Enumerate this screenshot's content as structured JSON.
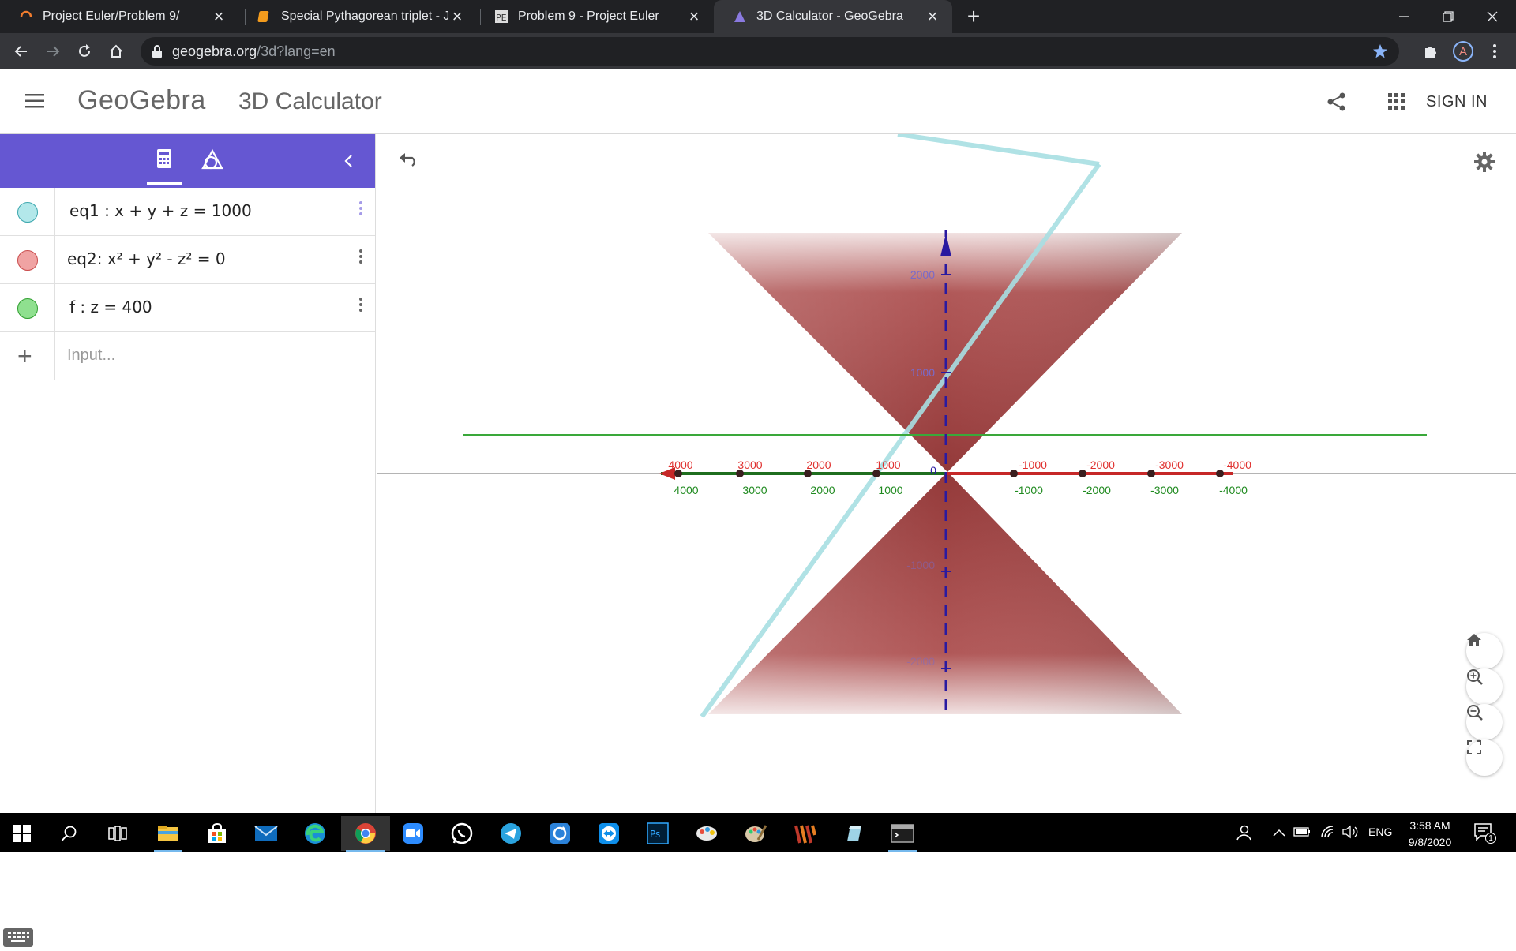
{
  "browser": {
    "tabs": [
      {
        "title": "Project Euler/Problem 9/",
        "icon": "loading-spinner-icon"
      },
      {
        "title": "Special Pythagorean triplet - Jupy",
        "icon": "notebook-icon"
      },
      {
        "title": "Problem 9 - Project Euler",
        "icon": "project-euler-icon"
      },
      {
        "title": "3D Calculator - GeoGebra",
        "icon": "geogebra-icon"
      }
    ],
    "active_tab_index": 3,
    "url_host": "geogebra.org",
    "url_path": "/3d?lang=en",
    "profile_initial": "A"
  },
  "app": {
    "logo": "GeoGebra",
    "name": "3D Calculator",
    "sign_in": "SIGN IN"
  },
  "algebra": {
    "rows": [
      {
        "expr": "eq1 : x + y + z = 1000",
        "color": "#b3e8ea",
        "border": "#3aa6ad"
      },
      {
        "expr": "eq2: x² + y² - z² = 0",
        "color": "#f0a3a3",
        "border": "#c94a4a"
      },
      {
        "expr": "f : z = 400",
        "color": "#8fe08f",
        "border": "#2e9e2e"
      }
    ],
    "input_placeholder": "Input..."
  },
  "graphics": {
    "x_ticks": [
      "4000",
      "3000",
      "2000",
      "1000",
      "0",
      "-1000",
      "-2000",
      "-3000",
      "-4000"
    ],
    "y_ticks": [
      "4000",
      "3000",
      "2000",
      "1000",
      "-1000",
      "-2000",
      "-3000",
      "-4000"
    ],
    "z_ticks": [
      "2000",
      "1000",
      "-1000",
      "-2000"
    ],
    "colors": {
      "axis_x": "#e0302e",
      "axis_y": "#1f8a1f",
      "axis_z": "#2a1aa0",
      "cone": "#a33b3b",
      "plane_eq1": "#a8dfe3",
      "plane_f": "#3aa83a"
    }
  },
  "taskbar": {
    "apps": [
      "start-icon",
      "search-icon",
      "task-view-icon",
      "file-explorer-icon",
      "store-icon",
      "mail-icon",
      "edge-icon",
      "chrome-icon",
      "zoom-icon",
      "whatsapp-icon",
      "telegram-icon",
      "sync-icon",
      "teamviewer-icon",
      "photoshop-icon",
      "paint-3d-icon",
      "paint-icon",
      "winrar-icon",
      "app-cube-icon",
      "terminal-icon"
    ],
    "lang": "ENG",
    "time": "3:58 AM",
    "date": "9/8/2020",
    "notifications": "1"
  }
}
